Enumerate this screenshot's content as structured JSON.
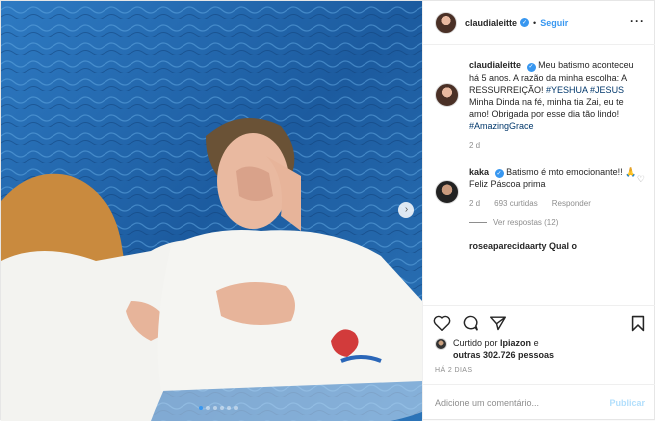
{
  "post": {
    "author": "claudialeitte",
    "follow_label": "Seguir",
    "separator": "•"
  },
  "caption": {
    "username": "claudialeitte",
    "text_plain": "Meu batismo aconteceu há 5 anos. A razão da minha escolha: A RESSURREIÇÃO!",
    "hashtags_1": "#YESHUA #JESUS",
    "text_plain_2": "Minha Dinda na fé, minha tia Zai, eu te amo! Obrigada por esse dia tão lindo!",
    "hashtag_2": "#AmazingGrace",
    "age": "2 d"
  },
  "comment": {
    "username": "kaka",
    "text": "Batismo é mto emocionante!! 🙏 Feliz Páscoa prima",
    "age": "2 d",
    "likes": "693 curtidas",
    "reply_label": "Responder",
    "view_replies": "Ver respostas (12)"
  },
  "partial_comment": {
    "text": "roseaparecidaarty Qual o"
  },
  "likes": {
    "prefix": "Curtido por",
    "user": "lpiazon",
    "connector": "e",
    "others": "outras 302.726 pessoas"
  },
  "timestamp": "HÁ 2 DIAS",
  "add_comment": {
    "placeholder": "Adicione um comentário...",
    "publish_label": "Publicar"
  },
  "icons": {
    "next": "chevron-right-icon",
    "like": "heart-icon",
    "comment": "comment-icon",
    "share": "share-icon",
    "save": "bookmark-icon",
    "more": "more-options-icon",
    "verified": "verified-badge-icon"
  },
  "carousel": {
    "current": 1,
    "total": 6
  },
  "colors": {
    "accent": "#3897f0",
    "water": "#1f63a8",
    "muted": "#8e8e8e"
  }
}
